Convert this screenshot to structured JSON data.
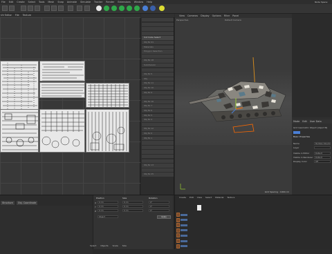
{
  "menubar": {
    "items": [
      "File",
      "Edit",
      "Create",
      "Select",
      "Tools",
      "Mesh",
      "Snap",
      "Animate",
      "Simulate",
      "Tracker",
      "Render",
      "Extensions",
      "Window",
      "Help"
    ],
    "layout_label": "Node Space:"
  },
  "uv_panel": {
    "menu": [
      "UV Editor",
      "File",
      "Texture"
    ]
  },
  "mid_column": {
    "rows": [
      "",
      "",
      "",
      "",
      "Cut Cube Select",
      "Obj Nr.41",
      "Materials",
      "Polygon Selection",
      "",
      "Obj Nr.18",
      "Subdivision",
      "",
      "Obj Nr.5",
      "Obj",
      "Obj Nr.11",
      "Obj Nr.10",
      "Obj Nr.9",
      "",
      "Obj Nr.16",
      "Obj Nr.7",
      "Obj Nr.6",
      "Obj Nr.5",
      "Obj Nr.4",
      "",
      "Obj Nr.12",
      "Obj Nr.0",
      "Obj Nr.1",
      "",
      "",
      "",
      "",
      "",
      "Obj Nr.13",
      "",
      "Obj Nr.25"
    ]
  },
  "viewport": {
    "menu": [
      "View",
      "Cameras",
      "Display",
      "Options",
      "Filter",
      "Panel"
    ],
    "camera_label": "Perspective",
    "default_camera": "Default Camera",
    "grid_spacing": "Grid Spacing : 1000 cm"
  },
  "right_panel": {
    "tabs": [
      "Mode",
      "Edit",
      "User Data"
    ],
    "object_title": "Grid Geometric Object [object B]",
    "basic_section": "Basic Properties",
    "fields": [
      {
        "label": "Name",
        "value": "Multiple Objects"
      },
      {
        "label": "Layer",
        "value": ""
      },
      {
        "label": "Visible in Editor",
        "value": "Default"
      },
      {
        "label": "Visible in Renderer",
        "value": "Default"
      },
      {
        "label": "Display Color",
        "value": "Off"
      }
    ]
  },
  "timeline": {
    "buttons": [
      "Structure",
      "Obj. Coordinate"
    ]
  },
  "attributes": {
    "headers": [
      "Position",
      "Size",
      "Rotation"
    ],
    "rows": [
      {
        "axis": "X",
        "pos": "0 cm",
        "size": "0 cm",
        "rot": "0°"
      },
      {
        "axis": "Y",
        "pos": "0 cm",
        "size": "0 cm",
        "rot": "0°"
      },
      {
        "axis": "Z",
        "pos": "0 cm",
        "size": "0 cm",
        "rot": "0°"
      }
    ],
    "mode": "Object",
    "apply": "Apply"
  },
  "layer_panel": {
    "menu": [
      "Create",
      "Edit",
      "View",
      "Select",
      "Material",
      "Texture"
    ]
  },
  "bottom_status": {
    "items": [
      "Select",
      "Objects",
      "Scale",
      "Size"
    ]
  },
  "colors": {
    "accent_green": "#2fa84a",
    "ground_orange": "#ff6a00",
    "axis_y": "#9acd32",
    "camo_dark": "#5a5650"
  }
}
